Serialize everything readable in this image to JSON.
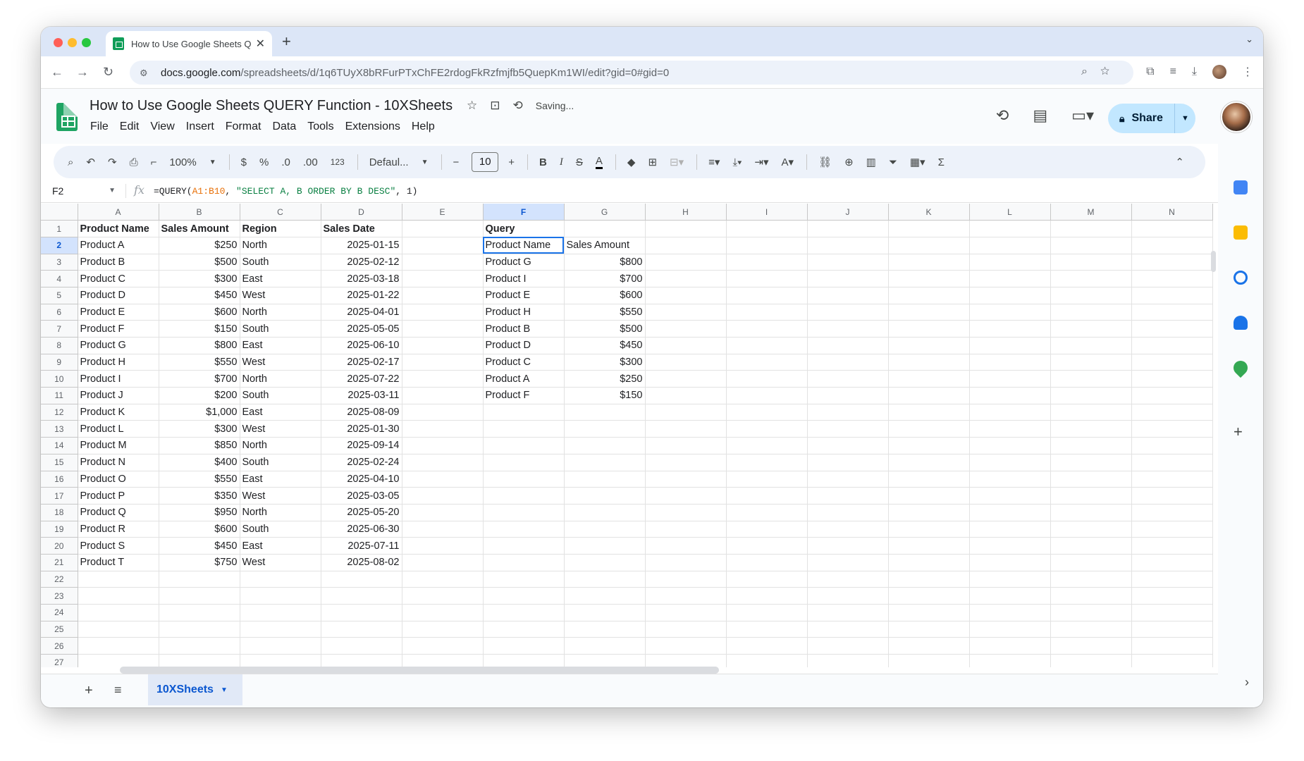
{
  "browser": {
    "tab_title": "How to Use Google Sheets QUERY Function - 10XSheets",
    "tab_title_short": "How to Use Google Sheets Q",
    "url_host": "docs.google.com",
    "url_path": "/spreadsheets/d/1q6TUyX8bRFurPTxChFE2rdogFkRzfmjfb5QuepKm1WI/edit?gid=0#gid=0"
  },
  "doc": {
    "title": "How to Use Google Sheets QUERY Function - 10XSheets",
    "status": "Saving...",
    "menus": [
      "File",
      "Edit",
      "View",
      "Insert",
      "Format",
      "Data",
      "Tools",
      "Extensions",
      "Help"
    ],
    "share_label": "Share"
  },
  "toolbar": {
    "zoom": "100%",
    "currency": "$",
    "percent": "%",
    "dec_less": ".0",
    "dec_more": ".00",
    "number_format": "123",
    "font": "Defaul...",
    "font_size": "10"
  },
  "formula_bar": {
    "cell_ref": "F2",
    "formula_prefix": "=QUERY(",
    "formula_range": "A1:B10",
    "formula_mid": ", ",
    "formula_string": "\"SELECT A, B ORDER BY B DESC\"",
    "formula_suffix": ", 1)"
  },
  "grid": {
    "columns": [
      "A",
      "B",
      "C",
      "D",
      "E",
      "F",
      "G",
      "H",
      "I",
      "J",
      "K",
      "L",
      "M",
      "N"
    ],
    "selected_column": "F",
    "selected_row": 2,
    "headers": [
      "Product Name",
      "Sales Amount",
      "Region",
      "Sales Date",
      "",
      "Query",
      "",
      "",
      "",
      "",
      "",
      "",
      "",
      ""
    ],
    "rows": [
      [
        "Product A",
        "$250",
        "North",
        "2025-01-15",
        "",
        "Product Name",
        "Sales Amount"
      ],
      [
        "Product B",
        "$500",
        "South",
        "2025-02-12",
        "",
        "Product G",
        "$800"
      ],
      [
        "Product C",
        "$300",
        "East",
        "2025-03-18",
        "",
        "Product I",
        "$700"
      ],
      [
        "Product D",
        "$450",
        "West",
        "2025-01-22",
        "",
        "Product E",
        "$600"
      ],
      [
        "Product E",
        "$600",
        "North",
        "2025-04-01",
        "",
        "Product H",
        "$550"
      ],
      [
        "Product F",
        "$150",
        "South",
        "2025-05-05",
        "",
        "Product B",
        "$500"
      ],
      [
        "Product G",
        "$800",
        "East",
        "2025-06-10",
        "",
        "Product D",
        "$450"
      ],
      [
        "Product H",
        "$550",
        "West",
        "2025-02-17",
        "",
        "Product C",
        "$300"
      ],
      [
        "Product I",
        "$700",
        "North",
        "2025-07-22",
        "",
        "Product A",
        "$250"
      ],
      [
        "Product J",
        "$200",
        "South",
        "2025-03-11",
        "",
        "Product F",
        "$150"
      ],
      [
        "Product K",
        "$1,000",
        "East",
        "2025-08-09",
        "",
        "",
        ""
      ],
      [
        "Product L",
        "$300",
        "West",
        "2025-01-30",
        "",
        "",
        ""
      ],
      [
        "Product M",
        "$850",
        "North",
        "2025-09-14",
        "",
        "",
        ""
      ],
      [
        "Product N",
        "$400",
        "South",
        "2025-02-24",
        "",
        "",
        ""
      ],
      [
        "Product O",
        "$550",
        "East",
        "2025-04-10",
        "",
        "",
        ""
      ],
      [
        "Product P",
        "$350",
        "West",
        "2025-03-05",
        "",
        "",
        ""
      ],
      [
        "Product Q",
        "$950",
        "North",
        "2025-05-20",
        "",
        "",
        ""
      ],
      [
        "Product R",
        "$600",
        "South",
        "2025-06-30",
        "",
        "",
        ""
      ],
      [
        "Product S",
        "$450",
        "East",
        "2025-07-11",
        "",
        "",
        ""
      ],
      [
        "Product T",
        "$750",
        "West",
        "2025-08-02",
        "",
        "",
        ""
      ]
    ],
    "empty_rows": [
      22,
      23,
      24,
      25,
      26,
      27
    ]
  },
  "sheet_tabs": [
    {
      "label": "10XSheets"
    }
  ],
  "colors": {
    "accent": "#1a73e8",
    "share_bg": "#c2e7ff",
    "sheets_green": "#1fa463"
  }
}
